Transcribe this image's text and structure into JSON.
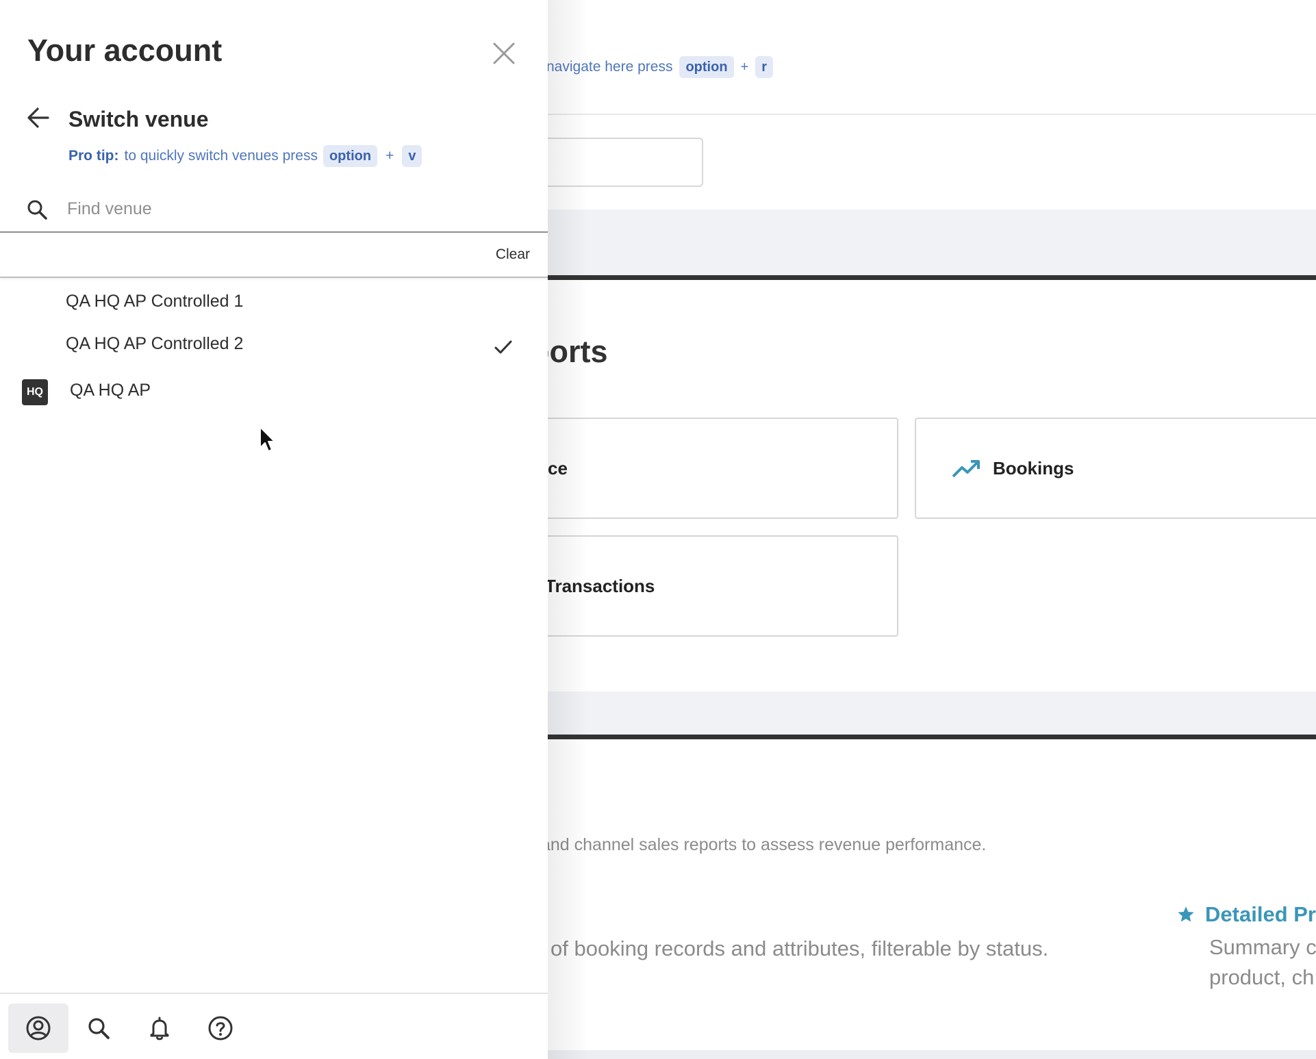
{
  "drawer": {
    "title": "Your account",
    "switch_venue_title": "Switch venue",
    "protip": {
      "label": "Pro tip:",
      "text": "to quickly switch venues press",
      "key1": "option",
      "plus": "+",
      "key2": "v"
    },
    "search": {
      "placeholder": "Find venue",
      "value": ""
    },
    "clear_label": "Clear",
    "venues": [
      {
        "label": "QA HQ AP Controlled 1",
        "selected": false
      },
      {
        "label": "QA HQ AP Controlled 2",
        "selected": true
      },
      {
        "label": "QA HQ AP",
        "badge": "HQ",
        "selected": false
      }
    ],
    "bottom_nav": [
      {
        "icon": "account-circle-icon",
        "active": true
      },
      {
        "icon": "search-icon",
        "active": false
      },
      {
        "icon": "bell-icon",
        "active": false
      },
      {
        "icon": "help-circle-icon",
        "active": false
      }
    ]
  },
  "background": {
    "shortcut": {
      "text": "navigate here press",
      "key1": "option",
      "plus": "+",
      "key2": "r"
    },
    "section_heading": "ports",
    "cards": [
      {
        "label": "ce"
      },
      {
        "label": "Bookings",
        "icon": "trending-up-icon"
      },
      {
        "label": "Transactions"
      }
    ],
    "desc_1": "and channel sales reports to assess revenue performance.",
    "desc_2": "of booking records and attributes, filterable by status.",
    "featured": {
      "title": "Detailed Pr",
      "desc_line1": "Summary c",
      "desc_line2": "product, ch",
      "icon": "star-icon"
    }
  },
  "colors": {
    "accent_blue": "#4f76bd",
    "kbd_bg": "#e3e9f6",
    "teal": "#3a96b8",
    "text_dark": "#2d2d2d"
  }
}
